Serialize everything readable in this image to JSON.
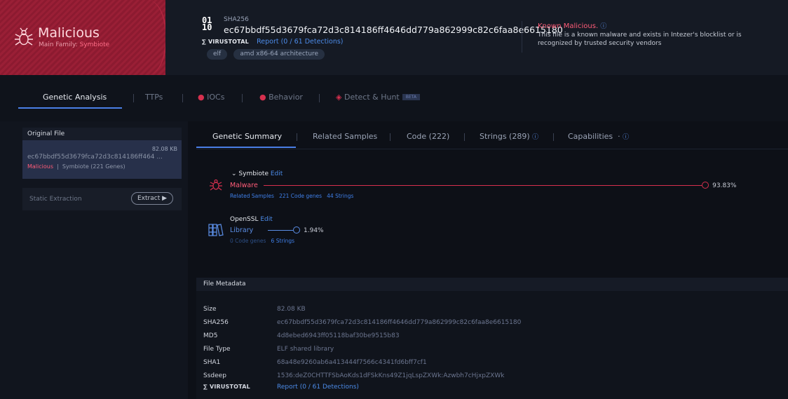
{
  "verdict": {
    "title": "Malicious",
    "family_label": "Main Family:",
    "family": "Symbiote"
  },
  "sample": {
    "digits_top": "01",
    "digits_bottom": "10",
    "hash_label": "SHA256",
    "sha256": "ec67bbdf55d3679fca72d3c814186ff4646dd779a862999c82c6faa8e6615180",
    "vt_logo": "VIRUSTOTAL",
    "vt_report": "Report (0 / 61 Detections)",
    "tags": [
      "elf",
      "amd x86-64 architecture"
    ]
  },
  "known": {
    "title": "Known Malicious.",
    "info_icon": "ⓘ",
    "description": "This file is a known malware and exists in Intezer's blocklist or is recognized by trusted security vendors"
  },
  "main_tabs": {
    "genetic": "Genetic Analysis",
    "ttps": "TTPs",
    "iocs": "IOCs",
    "behavior": "Behavior",
    "detect": "Detect & Hunt",
    "beta": "BETA"
  },
  "original_file": {
    "header": "Original File",
    "size": "82.08 KB",
    "hash_short": "ec67bbdf55d3679fca72d3c814186ff464 ...",
    "status": "Malicious",
    "family_genes": "Symbiote (221 Genes)"
  },
  "static_extraction": {
    "label": "Static Extraction",
    "button": "Extract ▶"
  },
  "sub_tabs": {
    "summary": "Genetic Summary",
    "related": "Related Samples",
    "code": "Code (222)",
    "strings": "Strings (289)",
    "capabilities": "Capabilities",
    "info_icon": "ⓘ"
  },
  "genes": [
    {
      "name": "Symbiote",
      "edit": "Edit",
      "type": "Malware",
      "links": [
        "Related Samples",
        "221 Code genes",
        "44 Strings"
      ],
      "percent": "93.83%",
      "fill": 0.9383,
      "color": "#d6304e",
      "icon": "bug-icon"
    },
    {
      "name": "OpenSSL",
      "edit": "Edit",
      "type": "Library",
      "links": [
        "0 Code genes",
        "6 Strings"
      ],
      "percent": "1.94%",
      "fill": 0.0194,
      "color": "#5b8ee6",
      "icon": "library-icon"
    }
  ],
  "metadata": {
    "header": "File Metadata",
    "rows": [
      {
        "key": "Size",
        "value": "82.08 KB"
      },
      {
        "key": "SHA256",
        "value": "ec67bbdf55d3679fca72d3c814186ff4646dd779a862999c82c6faa8e6615180"
      },
      {
        "key": "MD5",
        "value": "4d8ebed6943ff05118baf30be9515b83"
      },
      {
        "key": "File Type",
        "value": "ELF shared library"
      },
      {
        "key": "SHA1",
        "value": "68a48e9260ab6a413444f7566c4341fd6bff7cf1"
      },
      {
        "key": "Ssdeep",
        "value": "1536:deZ0CHTTFSbAoKds1dFSkKns49Z1jqLspZXWk:Azwbh7cHjxpZXWk"
      },
      {
        "key": "VIRUSTOTAL",
        "value": "Report (0 / 61 Detections)"
      }
    ]
  }
}
